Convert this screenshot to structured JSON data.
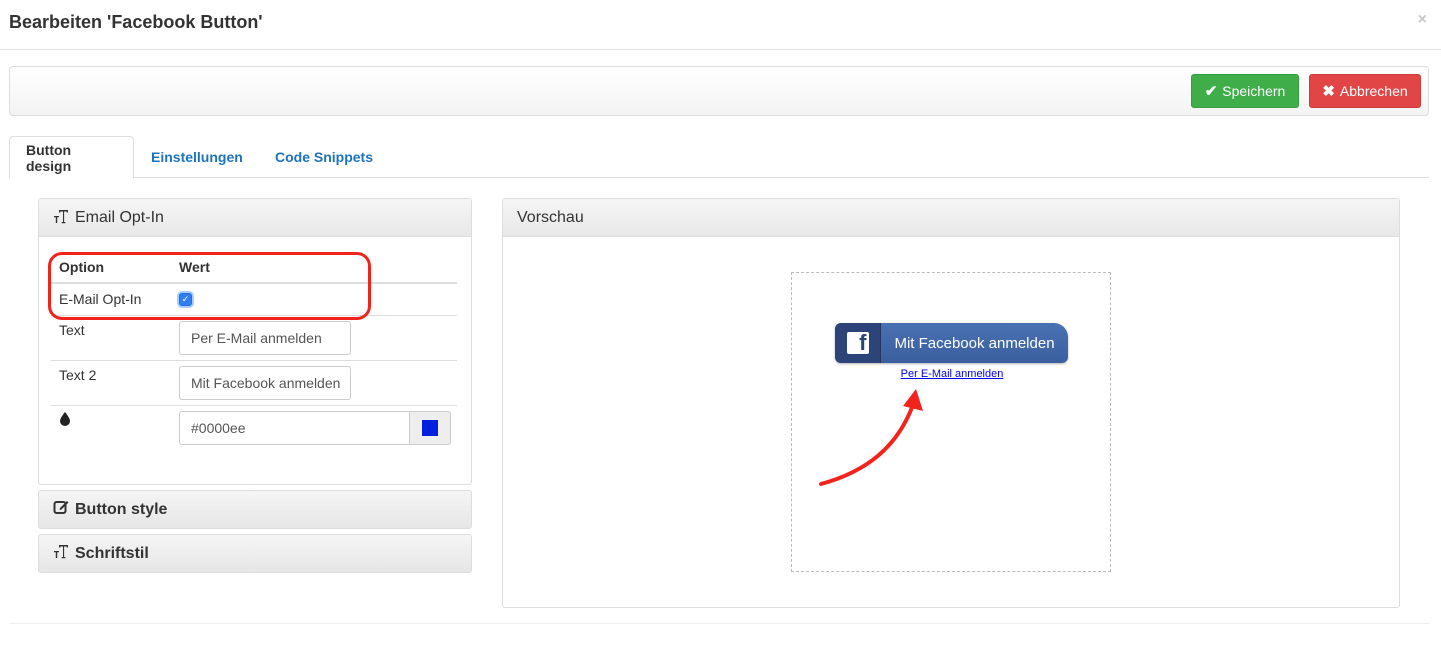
{
  "modal": {
    "title": "Bearbeiten 'Facebook Button'",
    "close": "×"
  },
  "toolbar": {
    "save_label": "Speichern",
    "cancel_label": "Abbrechen",
    "save_icon": "✔",
    "cancel_icon": "✖"
  },
  "tabs": [
    {
      "label": "Button design",
      "active": true
    },
    {
      "label": "Einstellungen",
      "active": false
    },
    {
      "label": "Code Snippets",
      "active": false
    }
  ],
  "email_panel": {
    "title": "Email Opt-In",
    "col_option": "Option",
    "col_value": "Wert",
    "rows": {
      "optin_label": "E-Mail Opt-In",
      "optin_checked": true,
      "text_label": "Text",
      "text_value": "Per E-Mail anmelden",
      "text2_label": "Text 2",
      "text2_value": "Mit Facebook anmelden",
      "color_value": "#0000ee"
    }
  },
  "collapsed_panels": {
    "button_style": "Button style",
    "schriftstil": "Schriftstil"
  },
  "preview": {
    "title": "Vorschau",
    "fb_button_text": "Mit Facebook anmelden",
    "email_link_text": "Per E-Mail anmelden"
  },
  "colors": {
    "save": "#3fae49",
    "cancel": "#e24546",
    "tab_link": "#1e73be",
    "highlight": "#f0241c",
    "link": "#0000ee",
    "facebook": "#3b5998"
  }
}
